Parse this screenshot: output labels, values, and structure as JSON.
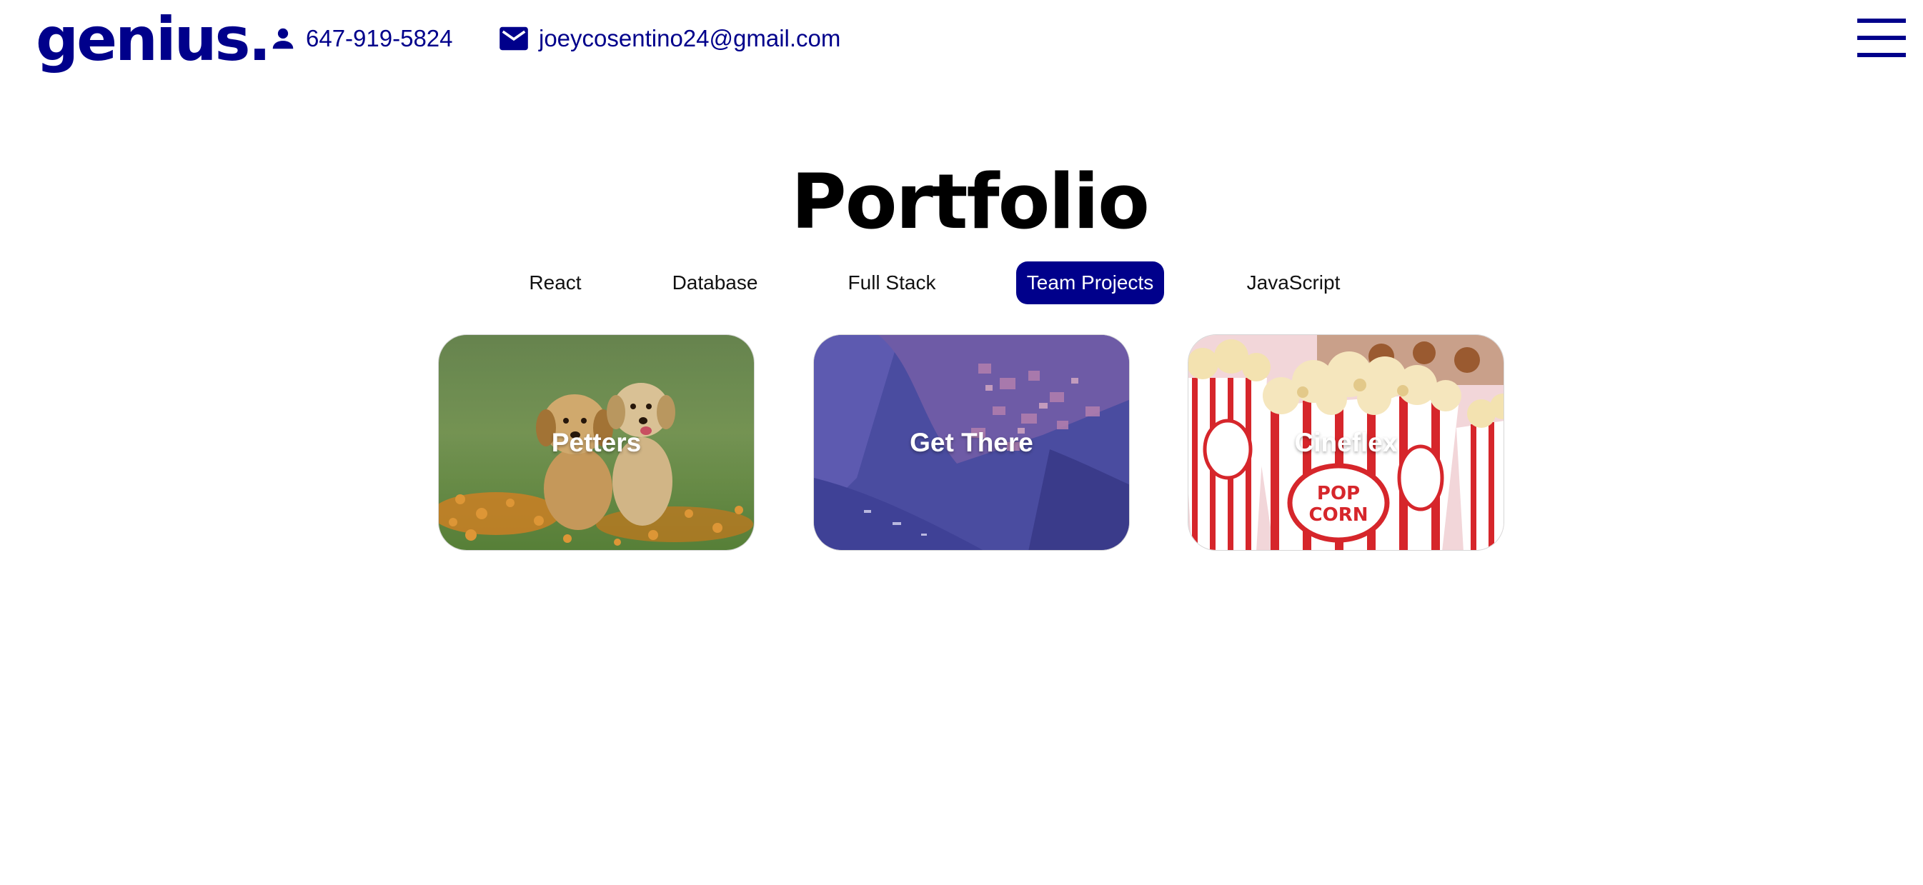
{
  "header": {
    "logo": "genius.",
    "phone": "647-919-5824",
    "email": "joeycosentino24@gmail.com",
    "phone_icon": "person-icon",
    "email_icon": "mail-icon",
    "menu_icon": "hamburger-menu-icon"
  },
  "main": {
    "title": "Portfolio",
    "tabs": [
      {
        "label": "React",
        "active": false
      },
      {
        "label": "Database",
        "active": false
      },
      {
        "label": "Full Stack",
        "active": false
      },
      {
        "label": "Team Projects",
        "active": true
      },
      {
        "label": "JavaScript",
        "active": false
      }
    ],
    "projects": [
      {
        "name": "Petters",
        "image": "puppies-in-flower-field"
      },
      {
        "name": "Get There",
        "image": "coastal-town-with-blue-overlay"
      },
      {
        "name": "Cineflex",
        "image": "popcorn-boxes"
      }
    ]
  },
  "colors": {
    "brand": "#00008b",
    "active_tab_text": "#ffffff",
    "text": "#111111"
  }
}
